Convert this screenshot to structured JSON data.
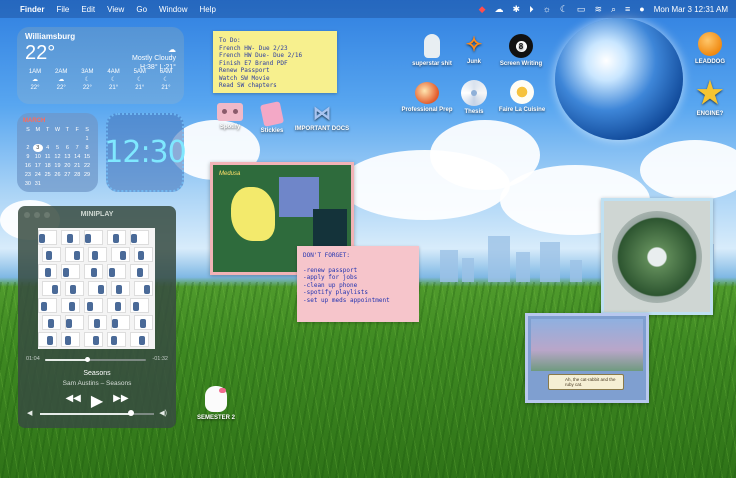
{
  "menubar": {
    "apple_icon": "apple-logo-icon",
    "items": [
      "Finder",
      "File",
      "Edit",
      "View",
      "Go",
      "Window",
      "Help"
    ],
    "datetime": "Mon Mar 3  12:31 AM"
  },
  "weather": {
    "location": "Williamsburg",
    "temperature": "22°",
    "condition": "Mostly Cloudy",
    "high_low": "H:38° L:21°",
    "hours": [
      {
        "time": "1AM",
        "icon": "cloud-icon",
        "temp": "22°"
      },
      {
        "time": "2AM",
        "icon": "cloud-icon",
        "temp": "22°"
      },
      {
        "time": "3AM",
        "icon": "moon-icon",
        "temp": "22°"
      },
      {
        "time": "4AM",
        "icon": "moon-icon",
        "temp": "21°"
      },
      {
        "time": "5AM",
        "icon": "moon-icon",
        "temp": "21°"
      },
      {
        "time": "6AM",
        "icon": "moon-icon",
        "temp": "21°"
      }
    ]
  },
  "calendar": {
    "month": "MARCH",
    "weekdays": [
      "S",
      "M",
      "T",
      "W",
      "T",
      "F",
      "S"
    ],
    "days": [
      "",
      "",
      "",
      "",
      "",
      "",
      "1",
      "2",
      "3",
      "4",
      "5",
      "6",
      "7",
      "8",
      "9",
      "10",
      "11",
      "12",
      "13",
      "14",
      "15",
      "16",
      "17",
      "18",
      "19",
      "20",
      "21",
      "22",
      "23",
      "24",
      "25",
      "26",
      "27",
      "28",
      "29",
      "30",
      "31"
    ],
    "today": "3"
  },
  "clock": {
    "time": "12:30"
  },
  "todo_note": {
    "lines": [
      "To Do:",
      "French HW- Due 2/23",
      "French HW Due- Due 2/16",
      "Finish E7 Brand PDF",
      "Renew Passport",
      "Watch SW Movie",
      "Read SW chapters"
    ]
  },
  "dontforget_note": {
    "title": "DON'T FORGET:",
    "lines": [
      "-renew passport",
      "-apply for jobs",
      "-clean up phone",
      "-spotify playlists",
      "-set up meds appointment"
    ]
  },
  "desktop_icons": [
    {
      "label": "Spotify",
      "icon": "cassette-tape-icon"
    },
    {
      "label": "Stickies",
      "icon": "pink-notebook-icon"
    },
    {
      "label": "IMPORTANT DOCS",
      "icon": "blue-bow-icon"
    },
    {
      "label": "superstar shit",
      "icon": "bunny-figurine-icon"
    },
    {
      "label": "Junk",
      "icon": "goldfish-icon"
    },
    {
      "label": "Screen Writing",
      "icon": "eight-ball-icon"
    },
    {
      "label": "Professional Prep",
      "icon": "apple-fruit-icon"
    },
    {
      "label": "Thesis",
      "icon": "cd-disc-icon"
    },
    {
      "label": "Faire La Cuisine",
      "icon": "egg-cup-icon"
    },
    {
      "label": "LEADDOG",
      "icon": "orange-fruit-icon"
    },
    {
      "label": "ENGINE?",
      "icon": "star-icon"
    },
    {
      "label": "SEMESTER 2",
      "icon": "hello-kitty-icon"
    }
  ],
  "miniplay": {
    "title": "MINIPLAY",
    "elapsed": "01:04",
    "remaining": "-01:32",
    "progress_fraction": 0.42,
    "song": "Seasons",
    "artist_album": "Sam Austins – Seasons",
    "volume_fraction": 0.8,
    "controls": {
      "prev": "◀◀",
      "play": "▶",
      "next": "▶▶"
    }
  },
  "pink_frame": {
    "caption": "Medusa"
  },
  "game_frame": {
    "dialog": "Ah, the cat-rabbit and the ruby cat."
  }
}
